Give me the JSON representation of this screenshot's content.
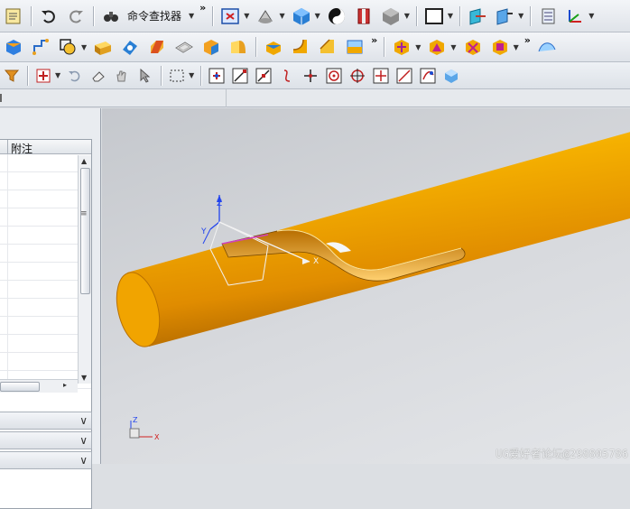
{
  "toolbar": {
    "command_finder_label": "命令查找器",
    "more_glyph": "»"
  },
  "navigator": {
    "column_header": "附注",
    "row_count": 13
  },
  "watermark": "UG爱好者论坛@298805786",
  "model": {
    "csys_labels": {
      "z": "Z",
      "y": "Y",
      "x": "X"
    },
    "corner_triad_labels": {
      "z": "Z",
      "x": "X"
    }
  },
  "colors": {
    "pipe": "#f0a800",
    "pipe_highlight": "#ffd54a",
    "pipe_shadow": "#a86200",
    "background_top": "#c5c8cd",
    "background_bottom": "#e3e5e8"
  }
}
